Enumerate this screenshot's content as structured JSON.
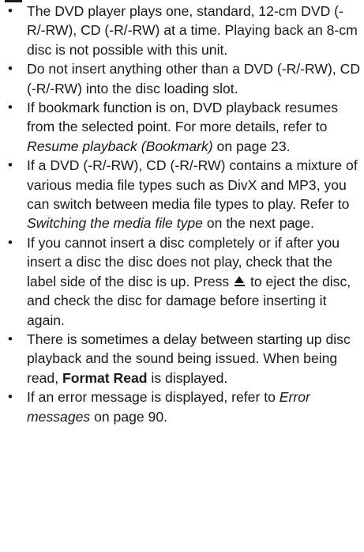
{
  "bullet_glyph": "•",
  "notes": [
    {
      "text": "The DVD player plays one, standard, 12-cm DVD (-R/-RW), CD (-R/-RW) at a time. Playing back an 8-cm disc is not possible with this unit."
    },
    {
      "text": "Do not insert anything other than a DVD (-R/-RW), CD (-R/-RW) into the disc loading slot."
    },
    {
      "text_before": "If bookmark function is on, DVD playback resumes from the selected point. For more details, refer to ",
      "ref": "Resume playback (Bookmark)",
      "text_after": " on page 23."
    },
    {
      "text_before": "If a DVD (-R/-RW), CD (-R/-RW) contains a mixture of various media file types such as DivX and MP3, you can switch between media file types to play. Refer to ",
      "ref": "Switching the media file type",
      "text_after": " on the next page."
    },
    {
      "text_before": "If you cannot insert a disc completely or if after you insert a disc the disc does not play, check that the label side of the disc is up. Press ",
      "icon": "eject-icon",
      "text_after": " to eject the disc, and check the disc for damage before inserting it again."
    },
    {
      "text_before": "There is sometimes a delay between starting up disc playback and the sound being issued. When being read, ",
      "bold": "Format Read",
      "text_after": " is displayed."
    },
    {
      "text_before": "If an error message is displayed, refer to ",
      "ref": "Error messages",
      "text_after": " on page 90."
    }
  ]
}
